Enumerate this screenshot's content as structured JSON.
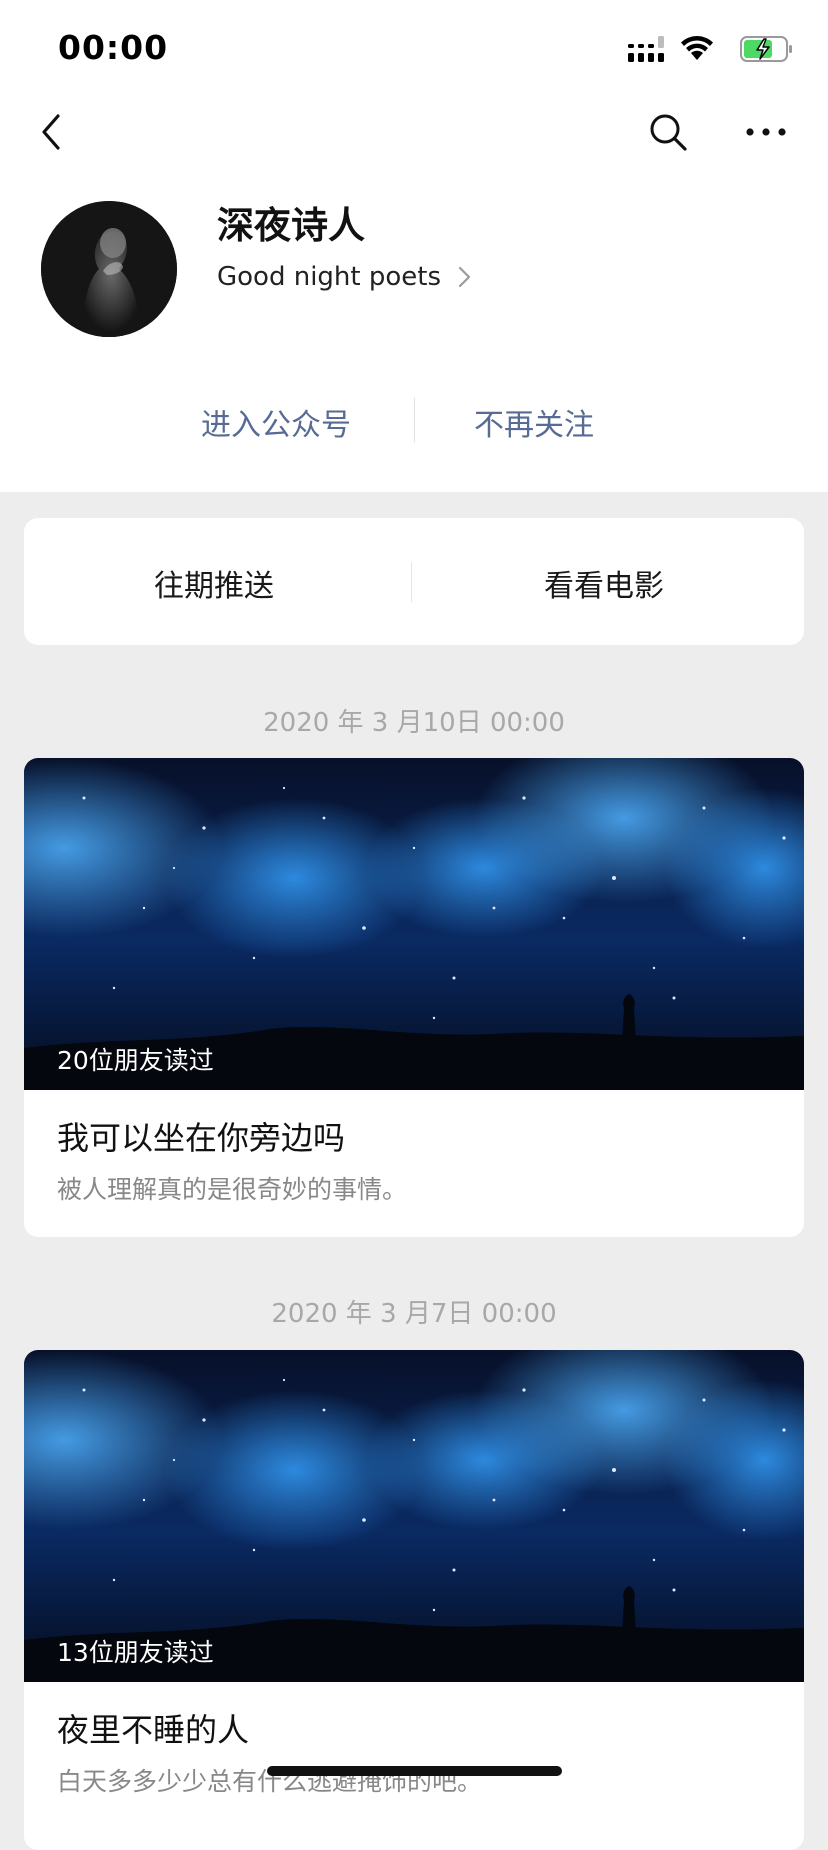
{
  "status_bar": {
    "time": "00:00"
  },
  "nav": {
    "back_icon": "chevron-left-icon",
    "search_icon": "search-icon",
    "more_icon": "more-icon"
  },
  "profile": {
    "name": "深夜诗人",
    "subtitle": "Good night poets",
    "actions": {
      "enter": "进入公众号",
      "unfollow": "不再关注"
    }
  },
  "menu": {
    "items": [
      "往期推送",
      "看看电影"
    ]
  },
  "feed": [
    {
      "date": "2020 年 3 月10日 00:00",
      "read_count": "20位朋友读过",
      "title": "我可以坐在你旁边吗",
      "desc": "被人理解真的是很奇妙的事情。"
    },
    {
      "date": "2020 年 3 月7日 00:00",
      "read_count": "13位朋友读过",
      "title": "夜里不睡的人",
      "desc": "白天多多少少总有什么逃避掩饰的吧。"
    }
  ],
  "colors": {
    "link": "#576b95",
    "background": "#ededed",
    "battery": "#4cd964"
  }
}
